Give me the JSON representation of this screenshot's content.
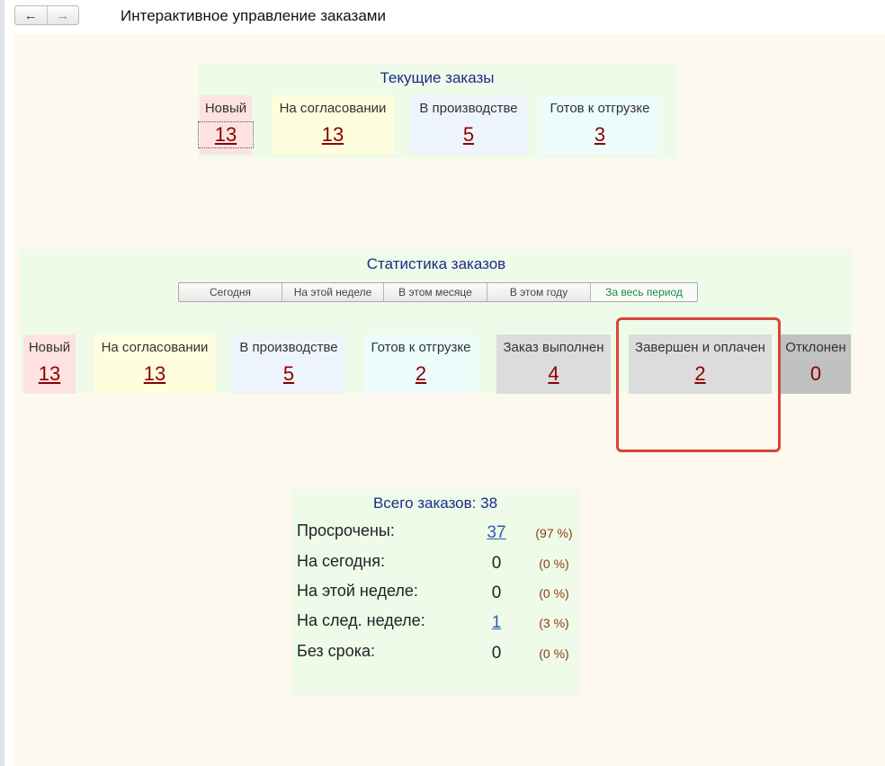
{
  "window": {
    "title": "Интерактивное управление заказами",
    "nav_back": "←",
    "nav_forward": "→"
  },
  "current_orders": {
    "title": "Текущие заказы",
    "tiles": [
      {
        "label": "Новый",
        "value": "13"
      },
      {
        "label": "На согласовании",
        "value": "13"
      },
      {
        "label": "В производстве",
        "value": "5"
      },
      {
        "label": "Готов к отгрузке",
        "value": "3"
      }
    ]
  },
  "statistics": {
    "title": "Статистика заказов",
    "periods": [
      {
        "label": "Сегодня",
        "active": false
      },
      {
        "label": "На этой неделе",
        "active": false
      },
      {
        "label": "В этом месяце",
        "active": false
      },
      {
        "label": "В этом году",
        "active": false
      },
      {
        "label": "За весь период",
        "active": true
      }
    ],
    "tiles": [
      {
        "label": "Новый",
        "value": "13"
      },
      {
        "label": "На согласовании",
        "value": "13"
      },
      {
        "label": "В производстве",
        "value": "5"
      },
      {
        "label": "Готов к отгрузке",
        "value": "2"
      },
      {
        "label": "Заказ выполнен",
        "value": "4"
      },
      {
        "label": "Завершен и оплачен",
        "value": "2"
      },
      {
        "label": "Отклонен",
        "value": "0"
      }
    ]
  },
  "summary": {
    "title": "Всего заказов: 38",
    "rows": [
      {
        "label": "Просрочены:",
        "count": "37",
        "percent": "(97 %)"
      },
      {
        "label": "На сегодня:",
        "count": "0",
        "percent": "(0 %)"
      },
      {
        "label": "На этой неделе:",
        "count": "0",
        "percent": "(0 %)"
      },
      {
        "label": "На след. неделе:",
        "count": "1",
        "percent": "(3 %)"
      },
      {
        "label": "Без срока:",
        "count": "0",
        "percent": "(0 %)"
      }
    ]
  },
  "colors": {
    "value_text": "#8b0000",
    "link_blue": "#2a5db0",
    "highlight_border": "#d9443a",
    "panel_green": "#eefbe9",
    "content_bg": "#fdf9ee"
  }
}
